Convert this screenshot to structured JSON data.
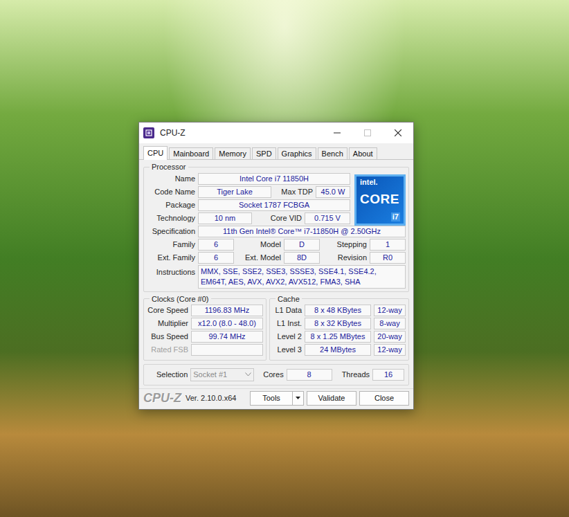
{
  "window": {
    "title": "CPU-Z",
    "controls": [
      {
        "kind": "minimize",
        "disabled": false
      },
      {
        "kind": "maximize",
        "disabled": true
      },
      {
        "kind": "close",
        "disabled": false
      }
    ]
  },
  "tabs": [
    {
      "label": "CPU",
      "selected": true
    },
    {
      "label": "Mainboard",
      "selected": false
    },
    {
      "label": "Memory",
      "selected": false
    },
    {
      "label": "SPD",
      "selected": false
    },
    {
      "label": "Graphics",
      "selected": false
    },
    {
      "label": "Bench",
      "selected": false
    },
    {
      "label": "About",
      "selected": false
    }
  ],
  "processor": {
    "title": "Processor",
    "name": {
      "label": "Name",
      "value": "Intel Core i7 11850H"
    },
    "code_name": {
      "label": "Code Name",
      "value": "Tiger Lake"
    },
    "max_tdp": {
      "label": "Max TDP",
      "value": "45.0 W"
    },
    "package": {
      "label": "Package",
      "value": "Socket 1787 FCBGA"
    },
    "technology": {
      "label": "Technology",
      "value": "10 nm"
    },
    "core_vid": {
      "label": "Core VID",
      "value": "0.715 V"
    },
    "specification": {
      "label": "Specification",
      "value": "11th Gen Intel® Core™ i7-11850H @ 2.50GHz"
    },
    "family": {
      "label": "Family",
      "value": "6"
    },
    "model": {
      "label": "Model",
      "value": "D"
    },
    "stepping": {
      "label": "Stepping",
      "value": "1"
    },
    "ext_family": {
      "label": "Ext. Family",
      "value": "6"
    },
    "ext_model": {
      "label": "Ext. Model",
      "value": "8D"
    },
    "revision": {
      "label": "Revision",
      "value": "R0"
    },
    "instructions": {
      "label": "Instructions",
      "value": "MMX, SSE, SSE2, SSE3, SSSE3, SSE4.1, SSE4.2, EM64T, AES, AVX, AVX2, AVX512, FMA3, SHA"
    }
  },
  "logo": {
    "brand": "intel.",
    "product": "CORE",
    "tier": "i7"
  },
  "clocks": {
    "title": "Clocks (Core #0)",
    "rows": [
      {
        "label": "Core Speed",
        "value": "1196.83 MHz",
        "disabled": false
      },
      {
        "label": "Multiplier",
        "value": "x12.0 (8.0 - 48.0)",
        "disabled": false
      },
      {
        "label": "Bus Speed",
        "value": "99.74 MHz",
        "disabled": false
      },
      {
        "label": "Rated FSB",
        "disabled": true
      }
    ]
  },
  "cache": {
    "title": "Cache",
    "rows": [
      {
        "label": "L1 Data",
        "size": "8 x 48 KBytes",
        "ways": "12-way"
      },
      {
        "label": "L1 Inst.",
        "size": "8 x 32 KBytes",
        "ways": "8-way"
      },
      {
        "label": "Level 2",
        "size": "8 x 1.25 MBytes",
        "ways": "20-way"
      },
      {
        "label": "Level 3",
        "size": "24 MBytes",
        "ways": "12-way"
      }
    ]
  },
  "selection": {
    "label": "Selection",
    "value": "Socket #1",
    "disabled": true
  },
  "cores": {
    "label": "Cores",
    "value": "8"
  },
  "threads": {
    "label": "Threads",
    "value": "16"
  },
  "footer": {
    "brand": "CPU-Z",
    "version": "Ver. 2.10.0.x64",
    "buttons": [
      {
        "label": "Tools",
        "kind": "split"
      },
      {
        "label": "Validate",
        "kind": "plain"
      },
      {
        "label": "Close",
        "kind": "plain"
      }
    ]
  }
}
